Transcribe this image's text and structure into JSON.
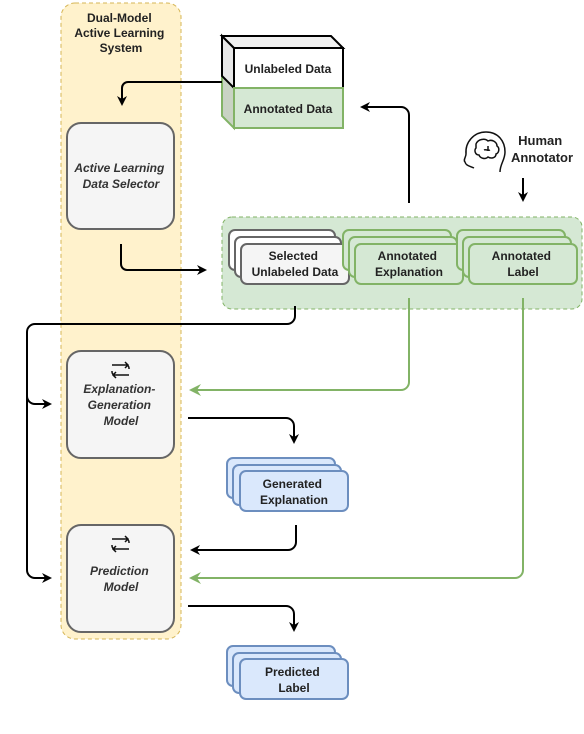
{
  "system": {
    "title_lines": [
      "Dual-Model",
      "Active Learning",
      "System"
    ]
  },
  "nodes": {
    "selector": {
      "lines": [
        "Active Learning",
        "Data Selector"
      ]
    },
    "explanation_model": {
      "lines": [
        "Explanation-",
        "Generation",
        "Model"
      ],
      "icon": "refresh-icon"
    },
    "prediction_model": {
      "lines": [
        "Prediction",
        "Model"
      ],
      "icon": "refresh-icon"
    },
    "unlabeled_data": {
      "label": "Unlabeled Data"
    },
    "annotated_data": {
      "label": "Annotated Data"
    },
    "selected_unlabeled": {
      "lines": [
        "Selected",
        "Unlabeled Data"
      ]
    },
    "annotated_explanation": {
      "lines": [
        "Annotated",
        "Explanation"
      ]
    },
    "annotated_label": {
      "lines": [
        "Annotated",
        "Label"
      ]
    },
    "generated_explanation": {
      "lines": [
        "Generated",
        "Explanation"
      ]
    },
    "predicted_label": {
      "lines": [
        "Predicted",
        "Label"
      ]
    },
    "human": {
      "lines": [
        "Human",
        "Annotator"
      ],
      "icon": "brain-head-icon"
    }
  },
  "colors": {
    "system_fill": "#fff2cc",
    "system_stroke": "#d6b656",
    "model_fill": "#f5f5f5",
    "model_stroke": "#666666",
    "green_fill": "#d5e8d4",
    "green_stroke": "#82b366",
    "blue_fill": "#dae8fc",
    "blue_stroke": "#6c8ebf"
  }
}
